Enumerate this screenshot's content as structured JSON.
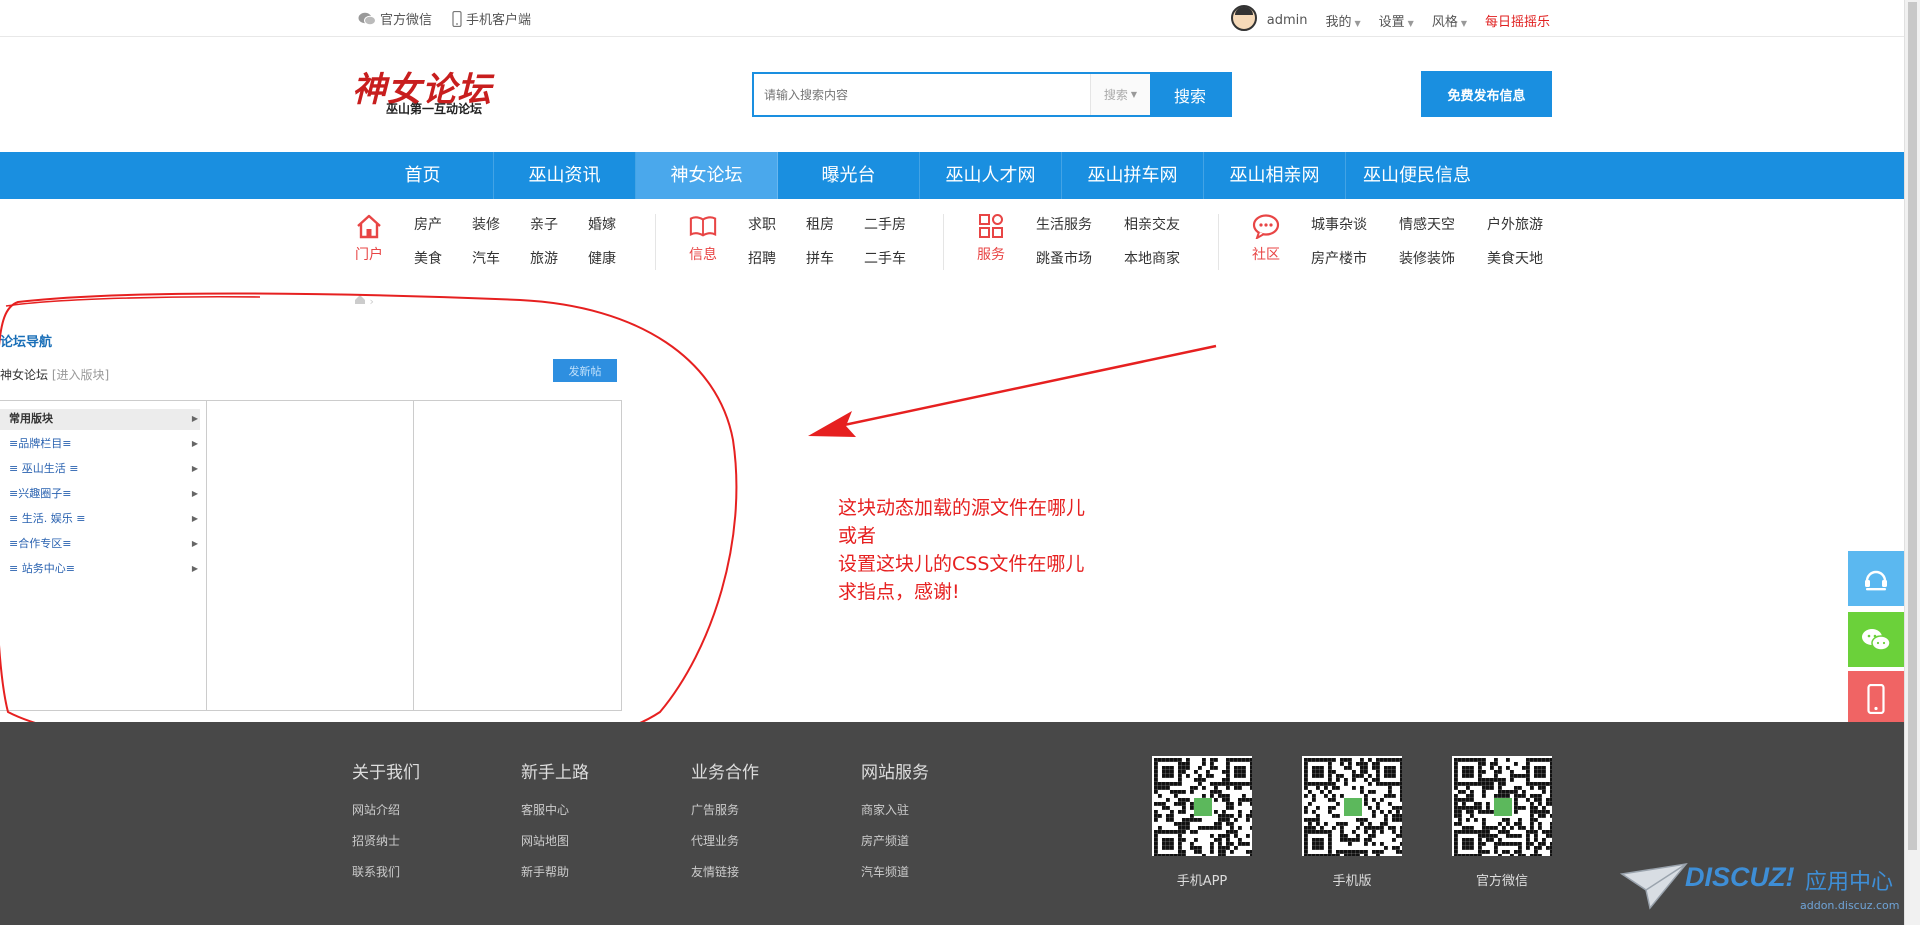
{
  "topbar": {
    "wechat": "官方微信",
    "mobile": "手机客户端",
    "username": "admin",
    "mine": "我的",
    "settings": "设置",
    "style": "风格",
    "daily": "每日摇摇乐"
  },
  "header": {
    "logo_name": "神女论坛",
    "logo_slogan": "巫山第一互动论坛",
    "search_placeholder": "请输入搜索内容",
    "search_select": "搜索",
    "search_button": "搜索",
    "publish_button": "免费发布信息"
  },
  "nav": [
    "首页",
    "巫山资讯",
    "神女论坛",
    "曝光台",
    "巫山人才网",
    "巫山拼车网",
    "巫山相亲网",
    "巫山便民信息"
  ],
  "nav_active": 2,
  "categories": [
    {
      "label": "门户",
      "links": [
        "房产",
        "装修",
        "亲子",
        "婚嫁",
        "美食",
        "汽车",
        "旅游",
        "健康"
      ]
    },
    {
      "label": "信息",
      "links": [
        "求职",
        "租房",
        "二手房",
        "招聘",
        "拼车",
        "二手车"
      ]
    },
    {
      "label": "服务",
      "links": [
        "生活服务",
        "相亲交友",
        "跳蚤市场",
        "本地商家"
      ]
    },
    {
      "label": "社区",
      "links": [
        "城事杂谈",
        "情感天空",
        "户外旅游",
        "房产楼市",
        "装修装饰",
        "美食天地"
      ]
    }
  ],
  "forum_nav": {
    "title": "论坛导航",
    "forum_name": "神女论坛",
    "enter": "[进入版块]",
    "new_post": "发新帖",
    "rows": [
      "常用版块",
      "≡品牌栏目≡",
      "≡ 巫山生活 ≡",
      "≡兴趣圈子≡",
      "≡ 生活. 娱乐 ≡",
      "≡合作专区≡",
      "≡ 站务中心≡"
    ]
  },
  "annotation": {
    "line1": "这块动态加载的源文件在哪儿",
    "line2": "或者",
    "line3": "设置这块儿的CSS文件在哪儿",
    "line4": "求指点，感谢!"
  },
  "footer": {
    "columns": [
      {
        "title": "关于我们",
        "links": [
          "网站介绍",
          "招贤纳士",
          "联系我们"
        ]
      },
      {
        "title": "新手上路",
        "links": [
          "客服中心",
          "网站地图",
          "新手帮助"
        ]
      },
      {
        "title": "业务合作",
        "links": [
          "广告服务",
          "代理业务",
          "友情链接"
        ]
      },
      {
        "title": "网站服务",
        "links": [
          "商家入驻",
          "房产频道",
          "汽车频道"
        ]
      }
    ],
    "qr_captions": [
      "手机APP",
      "手机版",
      "官方微信"
    ]
  },
  "watermark": {
    "brand": "DISCUZ!",
    "suffix": "应用中心",
    "url": "addon.discuz.com"
  },
  "colors": {
    "brand_blue": "#1a8fe0",
    "accent_red": "#e84545",
    "footer_bg": "#484848"
  }
}
